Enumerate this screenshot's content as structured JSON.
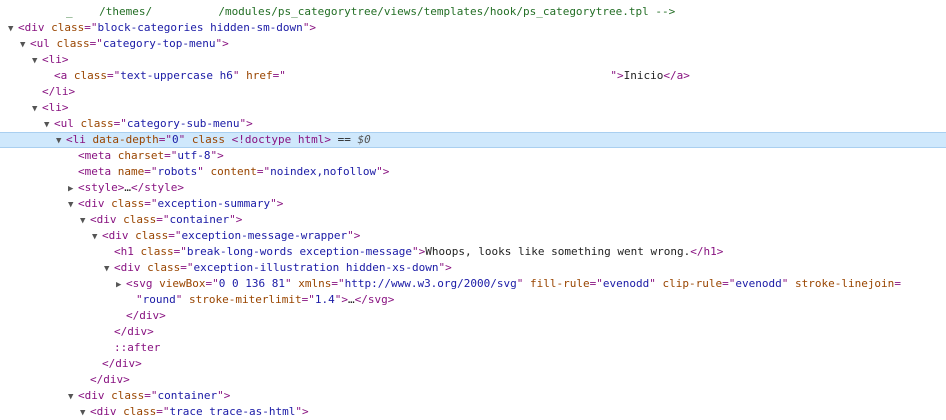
{
  "lines": [
    {
      "depth": 4,
      "toggle": "",
      "segs": [
        {
          "c": "cmt",
          "t": "_    /themes/          /modules/ps_categorytree/views/templates/hook/ps_categorytree.tpl -->"
        }
      ]
    },
    {
      "depth": 0,
      "toggle": "open",
      "segs": [
        {
          "c": "punct",
          "t": "<"
        },
        {
          "c": "tag",
          "t": "div"
        },
        {
          "c": "attr",
          "t": " class"
        },
        {
          "c": "punct",
          "t": "=\""
        },
        {
          "c": "val",
          "t": "block-categories hidden-sm-down"
        },
        {
          "c": "punct",
          "t": "\">"
        }
      ]
    },
    {
      "depth": 1,
      "toggle": "open",
      "segs": [
        {
          "c": "punct",
          "t": "<"
        },
        {
          "c": "tag",
          "t": "ul"
        },
        {
          "c": "attr",
          "t": " class"
        },
        {
          "c": "punct",
          "t": "=\""
        },
        {
          "c": "val",
          "t": "category-top-menu"
        },
        {
          "c": "punct",
          "t": "\">"
        }
      ]
    },
    {
      "depth": 2,
      "toggle": "open",
      "segs": [
        {
          "c": "punct",
          "t": "<"
        },
        {
          "c": "tag",
          "t": "li"
        },
        {
          "c": "punct",
          "t": ">"
        }
      ]
    },
    {
      "depth": 3,
      "toggle": "",
      "segs": [
        {
          "c": "punct",
          "t": "<"
        },
        {
          "c": "tag",
          "t": "a"
        },
        {
          "c": "attr",
          "t": " class"
        },
        {
          "c": "punct",
          "t": "=\""
        },
        {
          "c": "val",
          "t": "text-uppercase h6"
        },
        {
          "c": "punct",
          "t": "\""
        },
        {
          "c": "attr",
          "t": " href"
        },
        {
          "c": "punct",
          "t": "=\""
        },
        {
          "c": "val",
          "t": "                                                 "
        },
        {
          "c": "punct",
          "t": "\">"
        },
        {
          "c": "txt",
          "t": "Inicio"
        },
        {
          "c": "punct",
          "t": "</"
        },
        {
          "c": "tag",
          "t": "a"
        },
        {
          "c": "punct",
          "t": ">"
        }
      ]
    },
    {
      "depth": 2,
      "toggle": "",
      "segs": [
        {
          "c": "punct",
          "t": "</"
        },
        {
          "c": "tag",
          "t": "li"
        },
        {
          "c": "punct",
          "t": ">"
        }
      ]
    },
    {
      "depth": 2,
      "toggle": "open",
      "segs": [
        {
          "c": "punct",
          "t": "<"
        },
        {
          "c": "tag",
          "t": "li"
        },
        {
          "c": "punct",
          "t": ">"
        }
      ]
    },
    {
      "depth": 3,
      "toggle": "open",
      "segs": [
        {
          "c": "punct",
          "t": "<"
        },
        {
          "c": "tag",
          "t": "ul"
        },
        {
          "c": "attr",
          "t": " class"
        },
        {
          "c": "punct",
          "t": "=\""
        },
        {
          "c": "val",
          "t": "category-sub-menu"
        },
        {
          "c": "punct",
          "t": "\">"
        }
      ]
    },
    {
      "depth": 4,
      "toggle": "open",
      "selected": true,
      "segs": [
        {
          "c": "punct",
          "t": "<"
        },
        {
          "c": "tag",
          "t": "li"
        },
        {
          "c": "attr",
          "t": " data-depth"
        },
        {
          "c": "punct",
          "t": "=\""
        },
        {
          "c": "val",
          "t": "0"
        },
        {
          "c": "punct",
          "t": "\""
        },
        {
          "c": "attr",
          "t": " class"
        },
        {
          "c": "punct",
          "t": " <!doctype html>"
        },
        {
          "c": "txt",
          "t": " == "
        },
        {
          "c": "dim",
          "t": "$0"
        }
      ]
    },
    {
      "depth": 5,
      "toggle": "",
      "segs": [
        {
          "c": "punct",
          "t": "<"
        },
        {
          "c": "tag",
          "t": "meta"
        },
        {
          "c": "attr",
          "t": " charset"
        },
        {
          "c": "punct",
          "t": "=\""
        },
        {
          "c": "val",
          "t": "utf-8"
        },
        {
          "c": "punct",
          "t": "\">"
        }
      ]
    },
    {
      "depth": 5,
      "toggle": "",
      "segs": [
        {
          "c": "punct",
          "t": "<"
        },
        {
          "c": "tag",
          "t": "meta"
        },
        {
          "c": "attr",
          "t": " name"
        },
        {
          "c": "punct",
          "t": "=\""
        },
        {
          "c": "val",
          "t": "robots"
        },
        {
          "c": "punct",
          "t": "\""
        },
        {
          "c": "attr",
          "t": " content"
        },
        {
          "c": "punct",
          "t": "=\""
        },
        {
          "c": "val",
          "t": "noindex,nofollow"
        },
        {
          "c": "punct",
          "t": "\">"
        }
      ]
    },
    {
      "depth": 5,
      "toggle": "closed",
      "segs": [
        {
          "c": "punct",
          "t": "<"
        },
        {
          "c": "tag",
          "t": "style"
        },
        {
          "c": "punct",
          "t": ">"
        },
        {
          "c": "txt",
          "t": "…"
        },
        {
          "c": "punct",
          "t": "</"
        },
        {
          "c": "tag",
          "t": "style"
        },
        {
          "c": "punct",
          "t": ">"
        }
      ]
    },
    {
      "depth": 5,
      "toggle": "open",
      "segs": [
        {
          "c": "punct",
          "t": "<"
        },
        {
          "c": "tag",
          "t": "div"
        },
        {
          "c": "attr",
          "t": " class"
        },
        {
          "c": "punct",
          "t": "=\""
        },
        {
          "c": "val",
          "t": "exception-summary"
        },
        {
          "c": "punct",
          "t": "\">"
        }
      ]
    },
    {
      "depth": 6,
      "toggle": "open",
      "segs": [
        {
          "c": "punct",
          "t": "<"
        },
        {
          "c": "tag",
          "t": "div"
        },
        {
          "c": "attr",
          "t": " class"
        },
        {
          "c": "punct",
          "t": "=\""
        },
        {
          "c": "val",
          "t": "container"
        },
        {
          "c": "punct",
          "t": "\">"
        }
      ]
    },
    {
      "depth": 7,
      "toggle": "open",
      "segs": [
        {
          "c": "punct",
          "t": "<"
        },
        {
          "c": "tag",
          "t": "div"
        },
        {
          "c": "attr",
          "t": " class"
        },
        {
          "c": "punct",
          "t": "=\""
        },
        {
          "c": "val",
          "t": "exception-message-wrapper"
        },
        {
          "c": "punct",
          "t": "\">"
        }
      ]
    },
    {
      "depth": 8,
      "toggle": "",
      "segs": [
        {
          "c": "punct",
          "t": "<"
        },
        {
          "c": "tag",
          "t": "h1"
        },
        {
          "c": "attr",
          "t": " class"
        },
        {
          "c": "punct",
          "t": "=\""
        },
        {
          "c": "val",
          "t": "break-long-words exception-message"
        },
        {
          "c": "punct",
          "t": "\">"
        },
        {
          "c": "txt",
          "t": "Whoops, looks like something went wrong."
        },
        {
          "c": "punct",
          "t": "</"
        },
        {
          "c": "tag",
          "t": "h1"
        },
        {
          "c": "punct",
          "t": ">"
        }
      ]
    },
    {
      "depth": 8,
      "toggle": "open",
      "segs": [
        {
          "c": "punct",
          "t": "<"
        },
        {
          "c": "tag",
          "t": "div"
        },
        {
          "c": "attr",
          "t": " class"
        },
        {
          "c": "punct",
          "t": "=\""
        },
        {
          "c": "val",
          "t": "exception-illustration hidden-xs-down"
        },
        {
          "c": "punct",
          "t": "\">"
        }
      ]
    },
    {
      "depth": 9,
      "toggle": "closed",
      "segs": [
        {
          "c": "punct",
          "t": "<"
        },
        {
          "c": "tag",
          "t": "svg"
        },
        {
          "c": "attr",
          "t": " viewBox"
        },
        {
          "c": "punct",
          "t": "=\""
        },
        {
          "c": "val",
          "t": "0 0 136 81"
        },
        {
          "c": "punct",
          "t": "\""
        },
        {
          "c": "attr",
          "t": " xmlns"
        },
        {
          "c": "punct",
          "t": "=\""
        },
        {
          "c": "val",
          "t": "http://www.w3.org/2000/svg"
        },
        {
          "c": "punct",
          "t": "\""
        },
        {
          "c": "attr",
          "t": " fill-rule"
        },
        {
          "c": "punct",
          "t": "=\""
        },
        {
          "c": "val",
          "t": "evenodd"
        },
        {
          "c": "punct",
          "t": "\""
        },
        {
          "c": "attr",
          "t": " clip-rule"
        },
        {
          "c": "punct",
          "t": "=\""
        },
        {
          "c": "val",
          "t": "evenodd"
        },
        {
          "c": "punct",
          "t": "\""
        },
        {
          "c": "attr",
          "t": " stroke-linejoin"
        },
        {
          "c": "punct",
          "t": "="
        }
      ]
    },
    {
      "depth": 9,
      "toggle": "",
      "cont": true,
      "segs": [
        {
          "c": "punct",
          "t": "\""
        },
        {
          "c": "val",
          "t": "round"
        },
        {
          "c": "punct",
          "t": "\""
        },
        {
          "c": "attr",
          "t": " stroke-miterlimit"
        },
        {
          "c": "punct",
          "t": "=\""
        },
        {
          "c": "val",
          "t": "1.4"
        },
        {
          "c": "punct",
          "t": "\">"
        },
        {
          "c": "txt",
          "t": "…"
        },
        {
          "c": "punct",
          "t": "</"
        },
        {
          "c": "tag",
          "t": "svg"
        },
        {
          "c": "punct",
          "t": ">"
        }
      ]
    },
    {
      "depth": 9,
      "toggle": "",
      "segs": [
        {
          "c": "punct",
          "t": "</"
        },
        {
          "c": "tag",
          "t": "div"
        },
        {
          "c": "punct",
          "t": ">"
        }
      ]
    },
    {
      "depth": 8,
      "toggle": "",
      "segs": [
        {
          "c": "punct",
          "t": "</"
        },
        {
          "c": "tag",
          "t": "div"
        },
        {
          "c": "punct",
          "t": ">"
        }
      ]
    },
    {
      "depth": 8,
      "toggle": "",
      "segs": [
        {
          "c": "pseudo",
          "t": "::after"
        }
      ]
    },
    {
      "depth": 7,
      "toggle": "",
      "segs": [
        {
          "c": "punct",
          "t": "</"
        },
        {
          "c": "tag",
          "t": "div"
        },
        {
          "c": "punct",
          "t": ">"
        }
      ]
    },
    {
      "depth": 6,
      "toggle": "",
      "segs": [
        {
          "c": "punct",
          "t": "</"
        },
        {
          "c": "tag",
          "t": "div"
        },
        {
          "c": "punct",
          "t": ">"
        }
      ]
    },
    {
      "depth": 5,
      "toggle": "open",
      "segs": [
        {
          "c": "punct",
          "t": "<"
        },
        {
          "c": "tag",
          "t": "div"
        },
        {
          "c": "attr",
          "t": " class"
        },
        {
          "c": "punct",
          "t": "=\""
        },
        {
          "c": "val",
          "t": "container"
        },
        {
          "c": "punct",
          "t": "\">"
        }
      ]
    },
    {
      "depth": 6,
      "toggle": "open",
      "segs": [
        {
          "c": "punct",
          "t": "<"
        },
        {
          "c": "tag",
          "t": "div"
        },
        {
          "c": "attr",
          "t": " class"
        },
        {
          "c": "punct",
          "t": "=\""
        },
        {
          "c": "val",
          "t": "trace trace-as-html"
        },
        {
          "c": "punct",
          "t": "\">"
        }
      ]
    }
  ]
}
